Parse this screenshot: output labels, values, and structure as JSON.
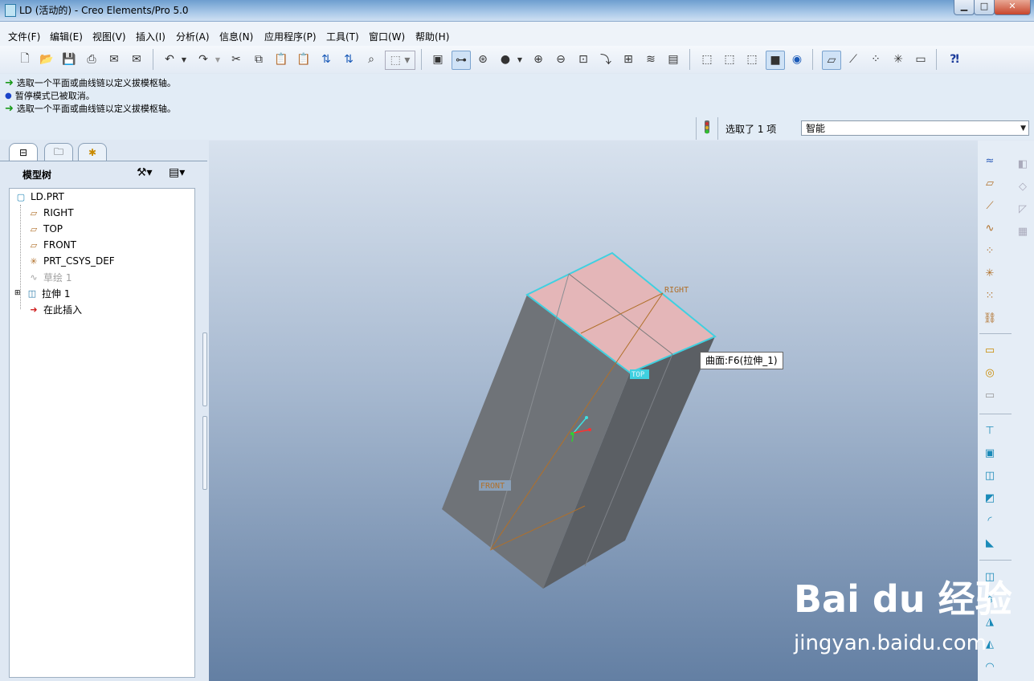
{
  "window": {
    "title": "LD (活动的) - Creo Elements/Pro 5.0",
    "buttons": [
      "▁",
      "□",
      "✕"
    ]
  },
  "menu": [
    "文件(F)",
    "编辑(E)",
    "视图(V)",
    "插入(I)",
    "分析(A)",
    "信息(N)",
    "应用程序(P)",
    "工具(T)",
    "窗口(W)",
    "帮助(H)"
  ],
  "messages": [
    {
      "icon": "green-arrow-icon",
      "text": "选取一个平面或曲线链以定义拔模枢轴。"
    },
    {
      "icon": "blue-dot-icon",
      "text": "暂停模式已被取消。"
    },
    {
      "icon": "green-arrow-icon",
      "text": "选取一个平面或曲线链以定义拔模枢轴。"
    }
  ],
  "status": {
    "selection_text": "选取了 1 项",
    "filter_value": "智能"
  },
  "model_tree": {
    "title": "模型树",
    "items": [
      {
        "label": "LD.PRT",
        "icon": "part-icon"
      },
      {
        "label": "RIGHT",
        "icon": "datum-plane-icon"
      },
      {
        "label": "TOP",
        "icon": "datum-plane-icon"
      },
      {
        "label": "FRONT",
        "icon": "datum-plane-icon"
      },
      {
        "label": "PRT_CSYS_DEF",
        "icon": "csys-icon"
      },
      {
        "label": "草绘 1",
        "icon": "sketch-icon"
      },
      {
        "label": "拉伸 1",
        "icon": "extrude-icon"
      },
      {
        "label": "在此插入",
        "icon": "insert-here-icon"
      }
    ]
  },
  "viewport": {
    "tooltip": "曲面:F6(拉伸_1)",
    "plane_labels": {
      "right": "RIGHT",
      "top": "TOP",
      "front": "FRONT"
    }
  },
  "watermark": {
    "logo": "Bai du 经验",
    "url": "jingyan.baidu.com"
  },
  "colors": {
    "selected_face": "#e4b6b8",
    "highlight_edge": "#3fd0e0",
    "body_front": "#6f7378",
    "body_side": "#5b5f64",
    "datum_line": "#b0702a"
  }
}
